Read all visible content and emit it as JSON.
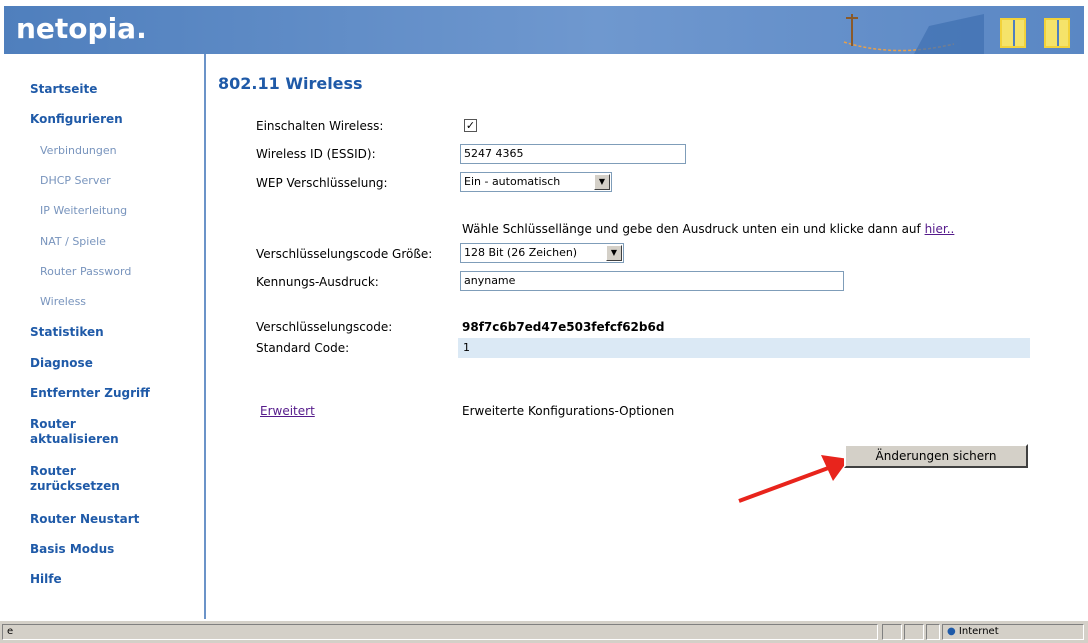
{
  "header": {
    "logo": "netopia."
  },
  "sidebar": {
    "items": [
      {
        "label": "Startseite"
      },
      {
        "label": "Konfigurieren"
      },
      {
        "label": "Verbindungen"
      },
      {
        "label": "DHCP Server"
      },
      {
        "label": "IP Weiterleitung"
      },
      {
        "label": "NAT / Spiele"
      },
      {
        "label": "Router Password"
      },
      {
        "label": "Wireless"
      },
      {
        "label": "Statistiken"
      },
      {
        "label": "Diagnose"
      },
      {
        "label": "Entfernter Zugriff"
      },
      {
        "label": "Router aktualisieren"
      },
      {
        "label": "Router zurücksetzen"
      },
      {
        "label": "Router Neustart"
      },
      {
        "label": "Basis Modus"
      },
      {
        "label": "Hilfe"
      }
    ]
  },
  "main": {
    "title": "802.11 Wireless",
    "enable_label": "Einschalten Wireless:",
    "enable_checked": true,
    "ssid_label": "Wireless ID (ESSID):",
    "ssid_value": "5247 4365",
    "wep_label": "WEP Verschlüsselung:",
    "wep_value": "Ein - automatisch",
    "hint_text": "Wähle Schlüssellänge und gebe den Ausdruck unten ein und klicke dann auf ",
    "hint_link": "hier..",
    "keysize_label": "Verschlüsselungscode Größe:",
    "keysize_value": "128 Bit (26 Zeichen)",
    "passphrase_label": "Kennungs-Ausdruck:",
    "passphrase_value": "anyname",
    "key_label": "Verschlüsselungscode:",
    "key_value": "98f7c6b7ed47e503fefcf62b6d",
    "std_label": "Standard Code:",
    "std_value": "1",
    "advanced_link": "Erweitert",
    "advanced_desc": "Erweiterte Konfigurations-Optionen",
    "save_button": "Änderungen sichern"
  },
  "statusbar": {
    "zone": "Internet"
  },
  "colors": {
    "header": "#5a87c4",
    "nav": "#1f5aa8",
    "accent_arrow": "#e8241c"
  },
  "icons": [
    "checkbox-icon",
    "dropdown-arrow-icon",
    "red-arrow-icon",
    "ie-page-icon",
    "internet-globe-icon"
  ]
}
